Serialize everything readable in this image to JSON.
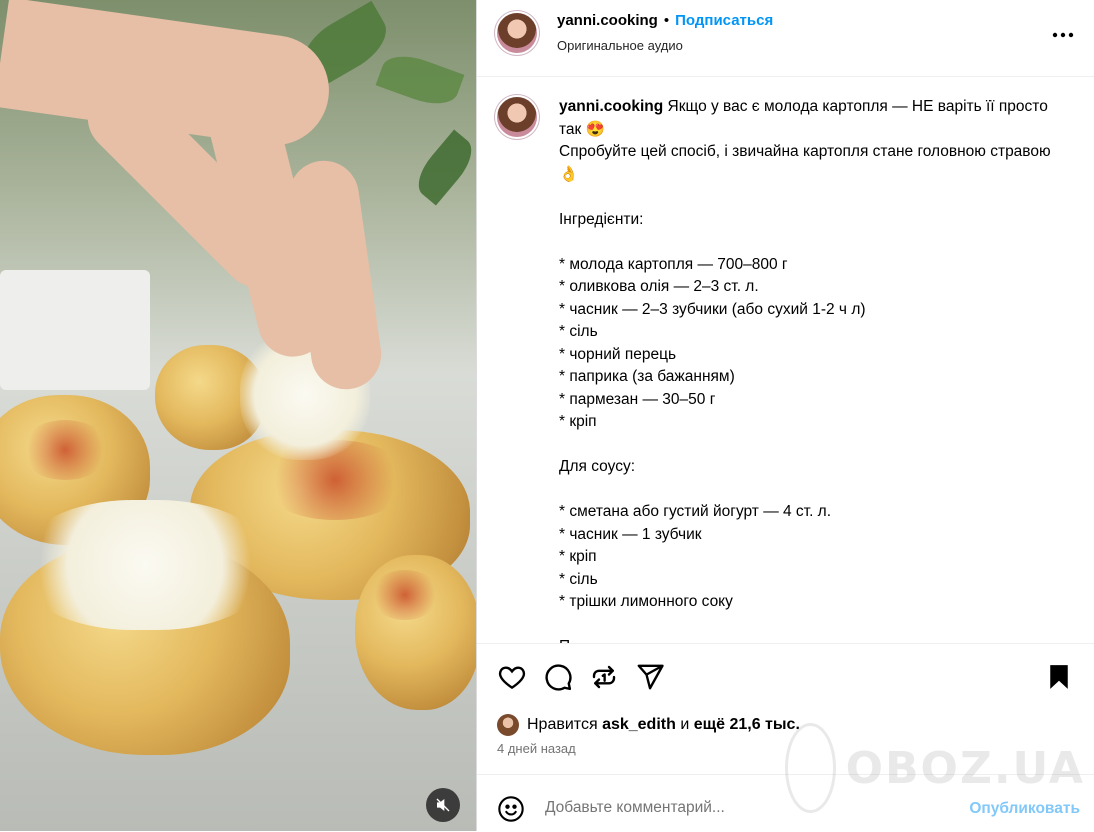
{
  "header": {
    "username": "yanni.cooking",
    "separator": "•",
    "follow_label": "Подписаться",
    "audio_label": "Оригинальное аудио",
    "more_icon": "more-horizontal-icon"
  },
  "caption": {
    "username": "yanni.cooking",
    "text": " Якщо у вас є молода картопля — НЕ варіть її просто так 😍\nСпробуйте цей спосіб, і звичайна картопля стане головною стравою 👌\n\nІнгредієнти:\n\n* молода картопля — 700–800 г\n* оливкова олія — 2–3 ст. л.\n* часник — 2–3 зубчики (або сухий 1-2 ч л)\n* сіль\n* чорний перець\n* паприка (за бажанням)\n* пармезан — 30–50 г\n* кріп\n\nДля соусу:\n\n* сметана або густий йогурт — 4 ст. л.\n* часник — 1 зубчик\n* кріп\n* сіль\n* трішки лимонного соку\n\nП"
  },
  "actions": {
    "icons": [
      "heart-icon",
      "comment-icon",
      "repost-icon",
      "share-icon",
      "bookmark-icon"
    ]
  },
  "likes": {
    "prefix": "Нравится",
    "user": "ask_edith",
    "middle": "и",
    "count_text": "ещё 21,6 тыс."
  },
  "time": "4 дней назад",
  "comment": {
    "placeholder": "Добавьте комментарий...",
    "publish_label": "Опубликовать"
  },
  "watermark": "OBOZ.UA",
  "media": {
    "mute_icon": "volume-muted-icon"
  }
}
